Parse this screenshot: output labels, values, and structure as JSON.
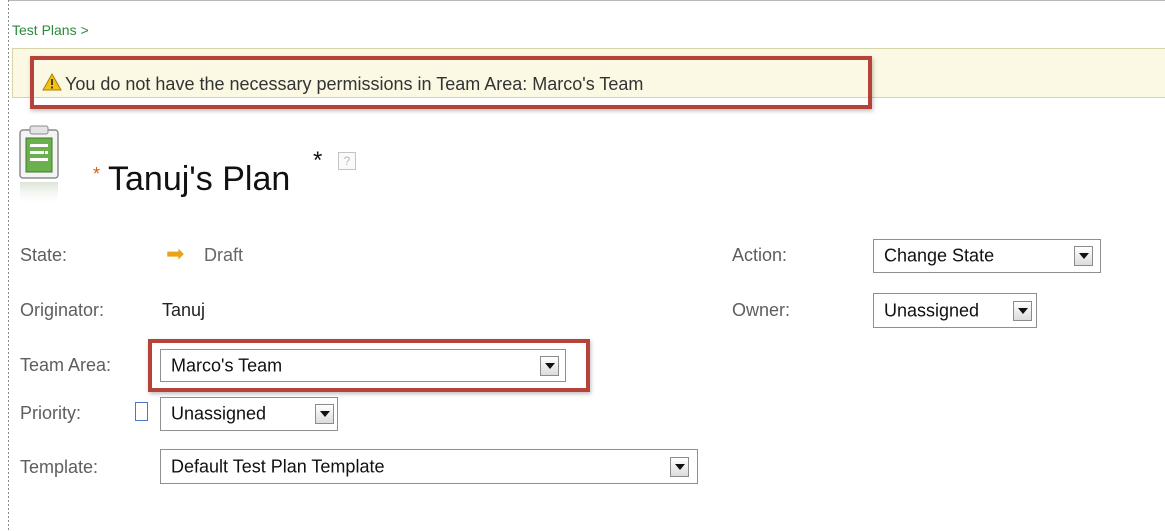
{
  "breadcrumb": {
    "label": "Test Plans >"
  },
  "warning": {
    "icon": "warning-triangle-icon",
    "message": "You do not have the necessary permissions in Team Area: Marco's Team"
  },
  "plan": {
    "icon": "test-plan-clipboard-icon",
    "required_marker": "*",
    "title": "Tanuj's Plan",
    "dirty_marker": "*",
    "help_label": "?"
  },
  "fields": {
    "state": {
      "label": "State:",
      "value": "Draft",
      "icon": "right-arrow-icon"
    },
    "originator": {
      "label": "Originator:",
      "value": "Tanuj"
    },
    "team_area": {
      "label": "Team Area:",
      "value": "Marco's Team"
    },
    "priority": {
      "label": "Priority:",
      "value": "Unassigned"
    },
    "template": {
      "label": "Template:",
      "value": "Default Test Plan Template"
    },
    "action": {
      "label": "Action:",
      "value": "Change State"
    },
    "owner": {
      "label": "Owner:",
      "value": "Unassigned"
    }
  },
  "colors": {
    "highlight_box": "#b6433a",
    "banner_background": "#fbf9e3",
    "breadcrumb_link": "#2a8a3a",
    "state_arrow": "#e8a317"
  }
}
